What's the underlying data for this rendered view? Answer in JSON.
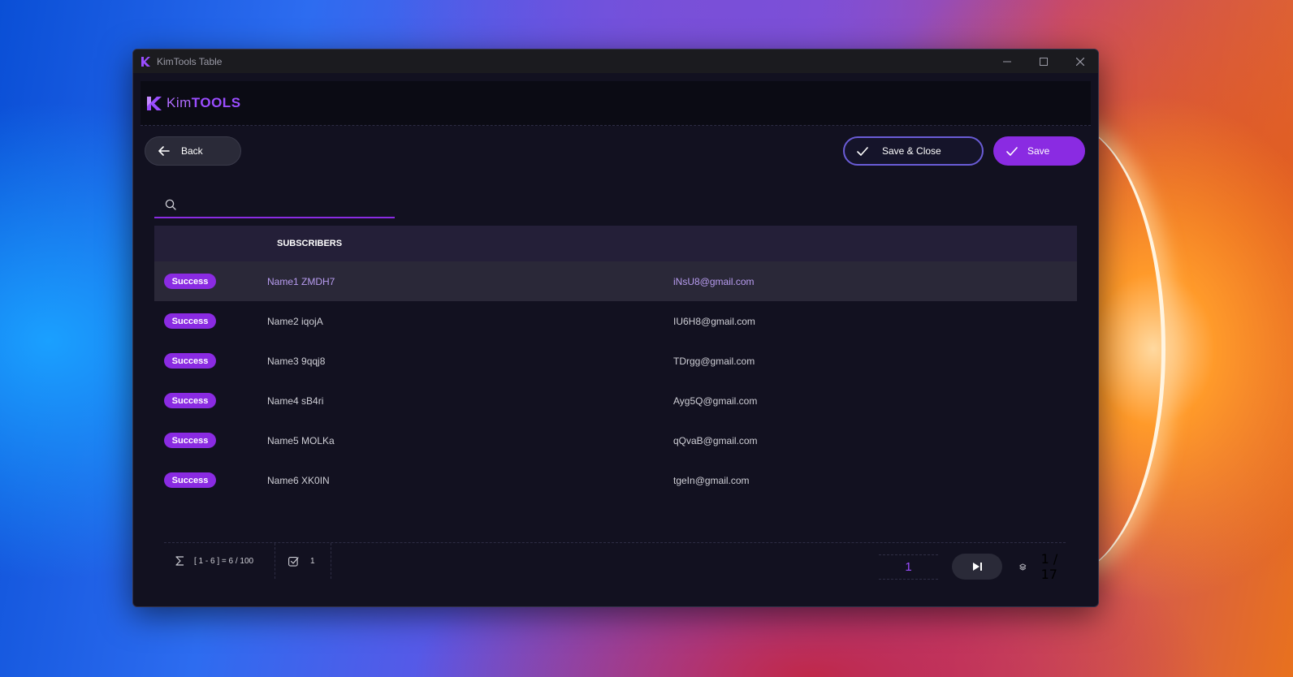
{
  "window": {
    "title": "KimTools Table"
  },
  "brand": {
    "prefix": "Kim",
    "suffix": "TOOLS"
  },
  "toolbar": {
    "back_label": "Back",
    "save_close_label": "Save & Close",
    "save_label": "Save"
  },
  "search": {
    "value": "",
    "placeholder": ""
  },
  "table": {
    "header": "SUBSCRIBERS",
    "rows": [
      {
        "status": "Success",
        "name": "Name1 ZMDH7",
        "email": "iNsU8@gmail.com",
        "selected": true
      },
      {
        "status": "Success",
        "name": "Name2 iqojA",
        "email": "IU6H8@gmail.com",
        "selected": false
      },
      {
        "status": "Success",
        "name": "Name3 9qqj8",
        "email": "TDrgg@gmail.com",
        "selected": false
      },
      {
        "status": "Success",
        "name": "Name4 sB4ri",
        "email": "Ayg5Q@gmail.com",
        "selected": false
      },
      {
        "status": "Success",
        "name": "Name5 MOLKa",
        "email": "qQvaB@gmail.com",
        "selected": false
      },
      {
        "status": "Success",
        "name": "Name6 XK0IN",
        "email": "tgeIn@gmail.com",
        "selected": false
      }
    ]
  },
  "footer": {
    "range": "[ 1 - 6 ] = 6 / 100",
    "selected_count": "1",
    "current_page": "1",
    "pages": "1 / 17"
  },
  "colors": {
    "accent": "#8a2be2",
    "background": "#121120",
    "header_row": "#241f38"
  },
  "icons": {
    "app": "kimtools-logo-icon",
    "back": "arrow-left-icon",
    "check": "check-icon",
    "search": "search-icon",
    "sum": "sigma-icon",
    "selected": "checkbox-checked-icon",
    "next": "skip-next-icon",
    "pages": "layers-icon"
  }
}
